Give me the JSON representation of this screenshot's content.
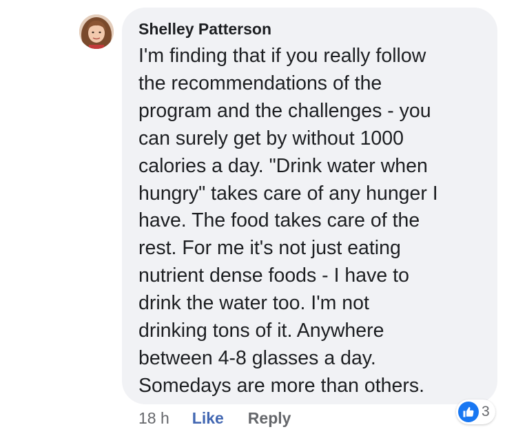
{
  "comment": {
    "author": "Shelley Patterson",
    "avatar_icon": "user-avatar",
    "text": "I'm finding that if you really follow\nthe recommendations of the\nprogram and the challenges - you\ncan surely get by without 1000\ncalories a day.  \"Drink water when\nhungry\" takes care of any hunger I\nhave.  The food takes care of the\nrest.  For me it's not just eating\nnutrient dense foods - I have to\ndrink the water too.  I'm not\ndrinking tons of it.  Anywhere\nbetween 4-8 glasses a day.\nSomedays are more than others.",
    "timestamp": "18 h",
    "like_label": "Like",
    "reply_label": "Reply",
    "reactions": {
      "icon": "thumbs-up-icon",
      "count": "3"
    }
  },
  "colors": {
    "bubble_bg": "#f1f2f5",
    "text": "#1c1e21",
    "meta": "#65676b",
    "like_link": "#4267b2",
    "like_badge": "#1877f2"
  }
}
